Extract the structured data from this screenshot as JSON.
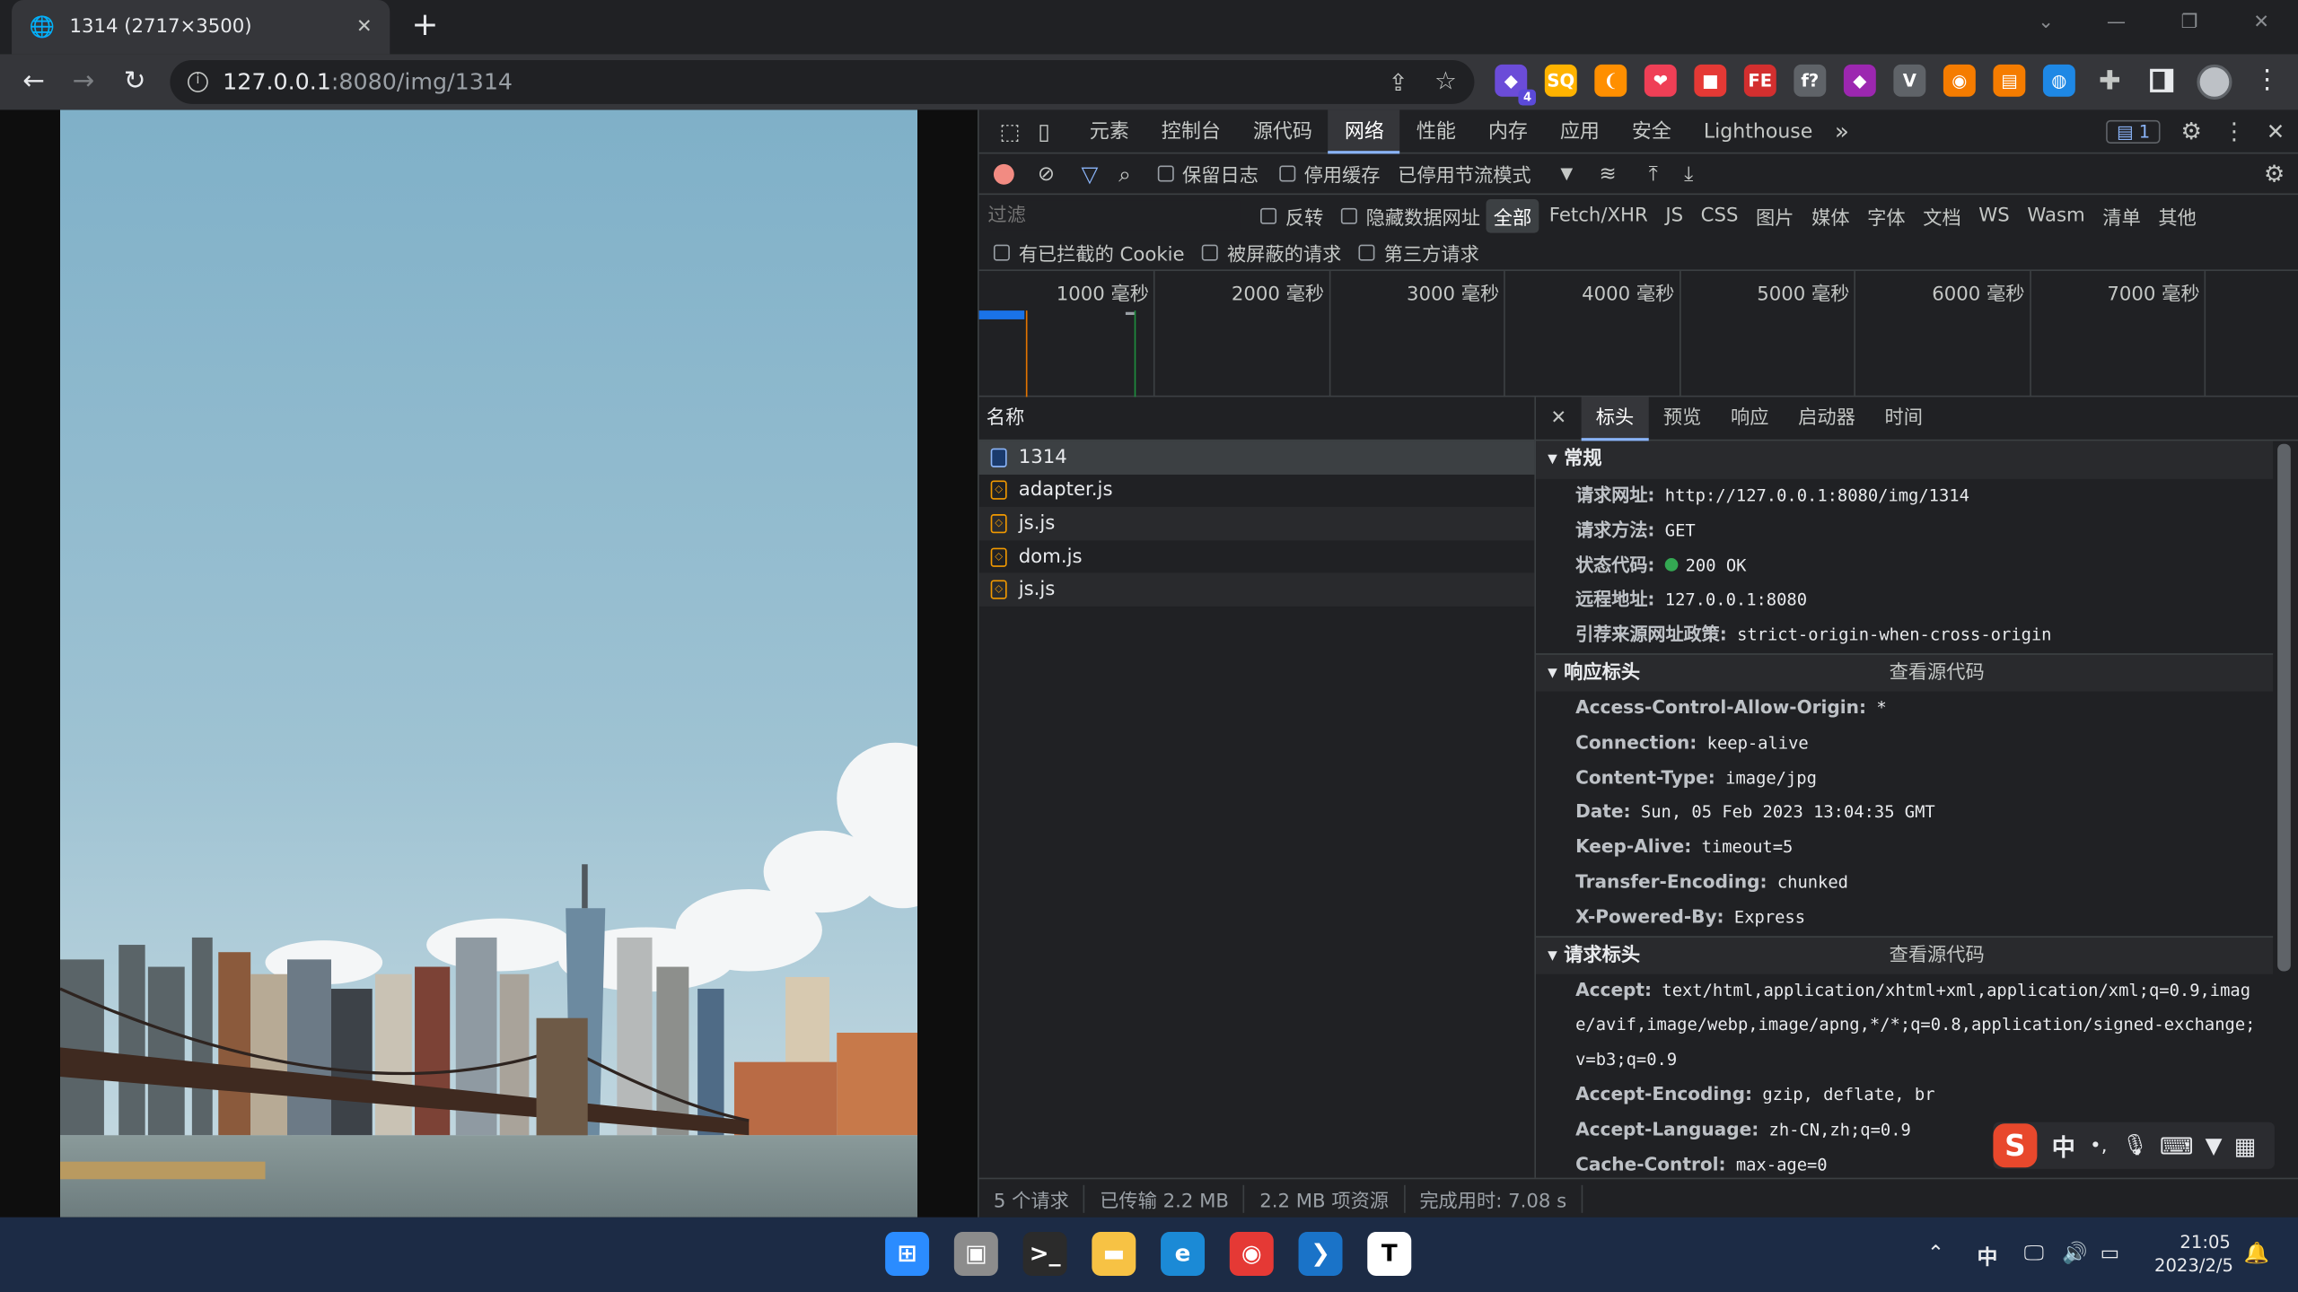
{
  "tab": {
    "title": "1314 (2717×3500)",
    "close": "✕",
    "new": "+"
  },
  "window": {
    "minimize": "—",
    "restore": "❐",
    "close": "✕",
    "dropdown": "⌄"
  },
  "address": {
    "host": "127.0.0.1",
    "path": ":8080/img/1314"
  },
  "extensions": [
    {
      "name": "ext-purple",
      "glyph": "◆",
      "badge": "4",
      "color": "#6b4cd8"
    },
    {
      "name": "ext-sq",
      "glyph": "SQ",
      "color": "#ffb300"
    },
    {
      "name": "ext-flame",
      "glyph": "❨",
      "color": "#ff8f00"
    },
    {
      "name": "ext-pocket",
      "glyph": "❤",
      "color": "#ef3f56"
    },
    {
      "name": "ext-cube",
      "glyph": "■",
      "color": "#e53935"
    },
    {
      "name": "ext-fe",
      "glyph": "FE",
      "color": "#d32f2f"
    },
    {
      "name": "ext-fx",
      "glyph": "f?",
      "color": "#5f6368"
    },
    {
      "name": "ext-gem",
      "glyph": "◆",
      "color": "#9c27b0"
    },
    {
      "name": "ext-v",
      "glyph": "V",
      "color": "#5f6368"
    },
    {
      "name": "ext-cookie",
      "glyph": "◉",
      "color": "#f57c00"
    },
    {
      "name": "ext-book",
      "glyph": "▤",
      "color": "#f57c00"
    },
    {
      "name": "ext-globe",
      "glyph": "◍",
      "color": "#1e88e5"
    }
  ],
  "devtools": {
    "tabs": [
      "元素",
      "控制台",
      "源代码",
      "网络",
      "性能",
      "内存",
      "应用",
      "安全",
      "Lighthouse"
    ],
    "active_tab": "网络",
    "more": "»",
    "issues_count": "1",
    "toolbar": {
      "preserve_log": "保留日志",
      "disable_cache": "停用缓存",
      "throttle": "已停用节流模式"
    },
    "filter": {
      "placeholder": "过滤",
      "invert": "反转",
      "hide_data_urls": "隐藏数据网址"
    },
    "types": [
      "全部",
      "Fetch/XHR",
      "JS",
      "CSS",
      "图片",
      "媒体",
      "字体",
      "文档",
      "WS",
      "Wasm",
      "清单",
      "其他"
    ],
    "filter2": {
      "blocked_cookies": "有已拦截的 Cookie",
      "blocked_requests": "被屏蔽的请求",
      "third_party": "第三方请求"
    },
    "timeline_ticks": [
      "1000 毫秒",
      "2000 毫秒",
      "3000 毫秒",
      "4000 毫秒",
      "5000 毫秒",
      "6000 毫秒",
      "7000 毫秒"
    ],
    "name_header": "名称",
    "requests": [
      {
        "name": "1314",
        "type": "doc"
      },
      {
        "name": "adapter.js",
        "type": "js"
      },
      {
        "name": "js.js",
        "type": "js"
      },
      {
        "name": "dom.js",
        "type": "js"
      },
      {
        "name": "js.js",
        "type": "js"
      }
    ],
    "detail_tabs": [
      "标头",
      "预览",
      "响应",
      "启动器",
      "时间"
    ],
    "general": {
      "title": "常规",
      "items": [
        {
          "k": "请求网址:",
          "v": "http://127.0.0.1:8080/img/1314"
        },
        {
          "k": "请求方法:",
          "v": "GET"
        },
        {
          "k": "状态代码:",
          "v": "200 OK"
        },
        {
          "k": "远程地址:",
          "v": "127.0.0.1:8080"
        },
        {
          "k": "引荐来源网址政策:",
          "v": "strict-origin-when-cross-origin"
        }
      ]
    },
    "response_headers": {
      "title": "响应标头",
      "view_source": "查看源代码",
      "items": [
        {
          "k": "Access-Control-Allow-Origin:",
          "v": "*"
        },
        {
          "k": "Connection:",
          "v": "keep-alive"
        },
        {
          "k": "Content-Type:",
          "v": "image/jpg"
        },
        {
          "k": "Date:",
          "v": "Sun, 05 Feb 2023 13:04:35 GMT"
        },
        {
          "k": "Keep-Alive:",
          "v": "timeout=5"
        },
        {
          "k": "Transfer-Encoding:",
          "v": "chunked"
        },
        {
          "k": "X-Powered-By:",
          "v": "Express"
        }
      ]
    },
    "request_headers": {
      "title": "请求标头",
      "view_source": "查看源代码",
      "items": [
        {
          "k": "Accept:",
          "v": "text/html,application/xhtml+xml,application/xml;q=0.9,imag"
        },
        {
          "k": "",
          "v": "e/avif,image/webp,image/apng,*/*;q=0.8,application/signed-exchange;"
        },
        {
          "k": "",
          "v": "v=b3;q=0.9"
        },
        {
          "k": "Accept-Encoding:",
          "v": "gzip, deflate, br"
        },
        {
          "k": "Accept-Language:",
          "v": "zh-CN,zh;q=0.9"
        },
        {
          "k": "Cache-Control:",
          "v": "max-age=0"
        }
      ]
    },
    "status": [
      "5 个请求",
      "已传输 2.2 MB",
      "2.2 MB 项资源",
      "完成用时: 7.08 s"
    ]
  },
  "ime": {
    "logo": "S",
    "lang": "中",
    "punct": "•,",
    "mic": "🎤",
    "keyboard": "⌨",
    "shirt": "👕",
    "grid": "▦"
  },
  "taskbar": {
    "lang": "中",
    "time": "21:05",
    "date": "2023/2/5",
    "apps": [
      {
        "name": "start",
        "glyph": "⊞",
        "color": "#2b8cff"
      },
      {
        "name": "task-view",
        "glyph": "▣",
        "color": "#8c8c8c"
      },
      {
        "name": "terminal",
        "glyph": ">_",
        "color": "#2b2b2b"
      },
      {
        "name": "file-explorer",
        "glyph": "▬",
        "color": "#f7c244"
      },
      {
        "name": "edge",
        "glyph": "e",
        "color": "#1b8ad6"
      },
      {
        "name": "chrome",
        "glyph": "◉",
        "color": "#e53935"
      },
      {
        "name": "vscode",
        "glyph": "❯",
        "color": "#1a73c8"
      },
      {
        "name": "typora",
        "glyph": "T",
        "color": "#ffffff"
      }
    ]
  }
}
